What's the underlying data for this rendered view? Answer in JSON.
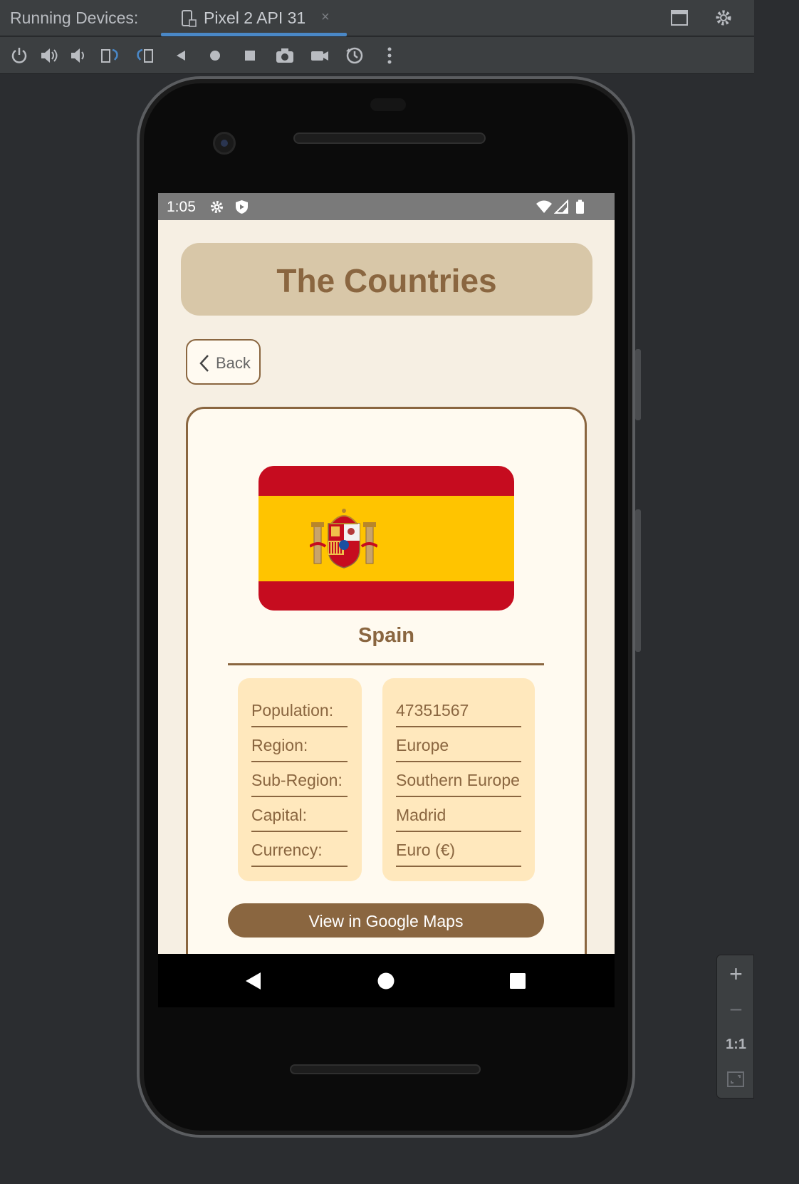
{
  "ide": {
    "panel_title": "Running Devices:",
    "tab_label": "Pixel 2 API 31",
    "tab_close": "×",
    "right_icons": [
      "window-layout-icon",
      "gear-icon"
    ],
    "toolbar_icons": [
      "power-icon",
      "volume-up-icon",
      "volume-down-icon",
      "rotate-left-icon",
      "rotate-right-icon",
      "back-icon",
      "home-icon",
      "overview-icon",
      "screenshot-icon",
      "screen-record-icon",
      "snapshot-icon",
      "more-icon"
    ],
    "zoom": {
      "plus": "+",
      "minus": "−",
      "actual": "1:1",
      "fit_icon": "fit-screen-icon"
    }
  },
  "status_bar": {
    "time": "1:05",
    "icons_left": [
      "settings-icon",
      "shield-icon"
    ],
    "icons_right": [
      "wifi-icon",
      "signal-icon",
      "battery-icon"
    ]
  },
  "app": {
    "header_title": "The Countries",
    "back_label": "Back",
    "country": {
      "name": "Spain",
      "flag_icon": "spain-flag",
      "labels": [
        "Population:",
        "Region:",
        "Sub-Region:",
        "Capital:",
        "Currency:"
      ],
      "values": [
        "47351567",
        "Europe",
        "Southern Europe",
        "Madrid",
        "Euro (€)"
      ]
    },
    "maps_button": "View in Google Maps"
  },
  "colors": {
    "brown": "#8a6640",
    "header_bg": "#d8c7a8",
    "screen_bg": "#f6efe3",
    "info_bg": "#ffe8bd",
    "flag_red": "#c60c1f",
    "flag_yellow": "#ffc400"
  }
}
